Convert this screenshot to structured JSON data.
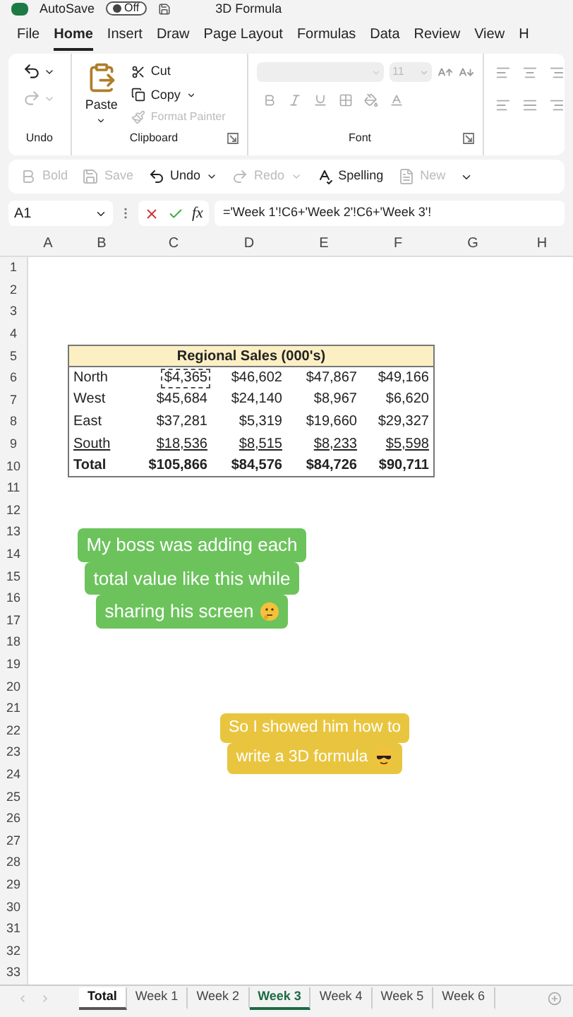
{
  "title_bar": {
    "autosave_label": "AutoSave",
    "autosave_toggle": {
      "label": "Off",
      "on": false
    },
    "file_name": "3D Formula"
  },
  "menu_tabs": [
    {
      "label": "File",
      "selected": false
    },
    {
      "label": "Home",
      "selected": true
    },
    {
      "label": "Insert",
      "selected": false
    },
    {
      "label": "Draw",
      "selected": false
    },
    {
      "label": "Page Layout",
      "selected": false
    },
    {
      "label": "Formulas",
      "selected": false
    },
    {
      "label": "Data",
      "selected": false
    },
    {
      "label": "Review",
      "selected": false
    },
    {
      "label": "View",
      "selected": false
    },
    {
      "label": "H",
      "selected": false
    }
  ],
  "ribbon": {
    "undo_group": {
      "label": "Undo",
      "redo_disabled": true
    },
    "clipboard_group": {
      "label": "Clipboard",
      "paste": "Paste",
      "cut": "Cut",
      "copy": "Copy",
      "format_painter": {
        "label": "Format Painter",
        "disabled": true
      }
    },
    "font_group": {
      "label": "Font",
      "font_size": "11"
    }
  },
  "quick_access": [
    {
      "kind": "bold",
      "label": "Bold",
      "disabled": true,
      "dropdown": false
    },
    {
      "kind": "save",
      "label": "Save",
      "disabled": true,
      "dropdown": false
    },
    {
      "kind": "undo",
      "label": "Undo",
      "disabled": false,
      "dropdown": true
    },
    {
      "kind": "redo",
      "label": "Redo",
      "disabled": true,
      "dropdown": true
    },
    {
      "kind": "spelling",
      "label": "Spelling",
      "disabled": false,
      "dropdown": false
    },
    {
      "kind": "new",
      "label": "New",
      "disabled": true,
      "dropdown": false
    }
  ],
  "formula_bar": {
    "name_box": "A1",
    "function_label": "fx",
    "formula": "='Week 1'!C6+'Week 2'!C6+'Week 3'!"
  },
  "sheet": {
    "columns": [
      "A",
      "B",
      "C",
      "D",
      "E",
      "F",
      "G",
      "H"
    ],
    "row_numbers": [
      "1",
      "2",
      "3",
      "4",
      "5",
      "6",
      "7",
      "8",
      "9",
      "10",
      "11",
      "12",
      "13",
      "14",
      "15",
      "16",
      "17",
      "18",
      "19",
      "20",
      "21",
      "22",
      "23",
      "24",
      "25",
      "26",
      "27",
      "28",
      "29",
      "30",
      "31",
      "32",
      "33"
    ],
    "table": {
      "title": "Regional Sales (000's)",
      "rows": [
        {
          "kind": "normal",
          "cells": [
            {
              "text": "North",
              "selected": false
            },
            {
              "text": "$4,365",
              "selected": true
            },
            {
              "text": "$46,602",
              "selected": false
            },
            {
              "text": "$47,867",
              "selected": false
            },
            {
              "text": "$49,166",
              "selected": false
            }
          ]
        },
        {
          "kind": "normal",
          "cells": [
            {
              "text": "West",
              "selected": false
            },
            {
              "text": "$45,684",
              "selected": false
            },
            {
              "text": "$24,140",
              "selected": false
            },
            {
              "text": "$8,967",
              "selected": false
            },
            {
              "text": "$6,620",
              "selected": false
            }
          ]
        },
        {
          "kind": "normal",
          "cells": [
            {
              "text": "East",
              "selected": false
            },
            {
              "text": "$37,281",
              "selected": false
            },
            {
              "text": "$5,319",
              "selected": false
            },
            {
              "text": "$19,660",
              "selected": false
            },
            {
              "text": "$29,327",
              "selected": false
            }
          ]
        },
        {
          "kind": "underline",
          "cells": [
            {
              "text": "South",
              "selected": false
            },
            {
              "text": "$18,536",
              "selected": false
            },
            {
              "text": "$8,515",
              "selected": false
            },
            {
              "text": "$8,233",
              "selected": false
            },
            {
              "text": "$5,598",
              "selected": false
            }
          ]
        },
        {
          "kind": "total",
          "cells": [
            {
              "text": "Total",
              "selected": false
            },
            {
              "text": "$105,866",
              "selected": false
            },
            {
              "text": "$84,576",
              "selected": false
            },
            {
              "text": "$84,726",
              "selected": false
            },
            {
              "text": "$90,711",
              "selected": false
            }
          ]
        }
      ]
    }
  },
  "captions": [
    {
      "color": "#6cc35c",
      "lines": [
        "My boss was adding each",
        "total value like this while",
        "sharing his screen"
      ]
    },
    {
      "color": "#e9c53f",
      "lines": [
        "So I showed him how to",
        "write a 3D formula"
      ]
    }
  ],
  "sheet_tabs": [
    {
      "label": "Total",
      "active": true,
      "selected": true
    },
    {
      "label": "Week 1",
      "active": false,
      "selected": false
    },
    {
      "label": "Week 2",
      "active": false,
      "selected": false
    },
    {
      "label": "Week 3",
      "active": false,
      "selected": true
    },
    {
      "label": "Week 4",
      "active": false,
      "selected": false
    },
    {
      "label": "Week 5",
      "active": false,
      "selected": false
    },
    {
      "label": "Week 6",
      "active": false,
      "selected": false
    }
  ]
}
